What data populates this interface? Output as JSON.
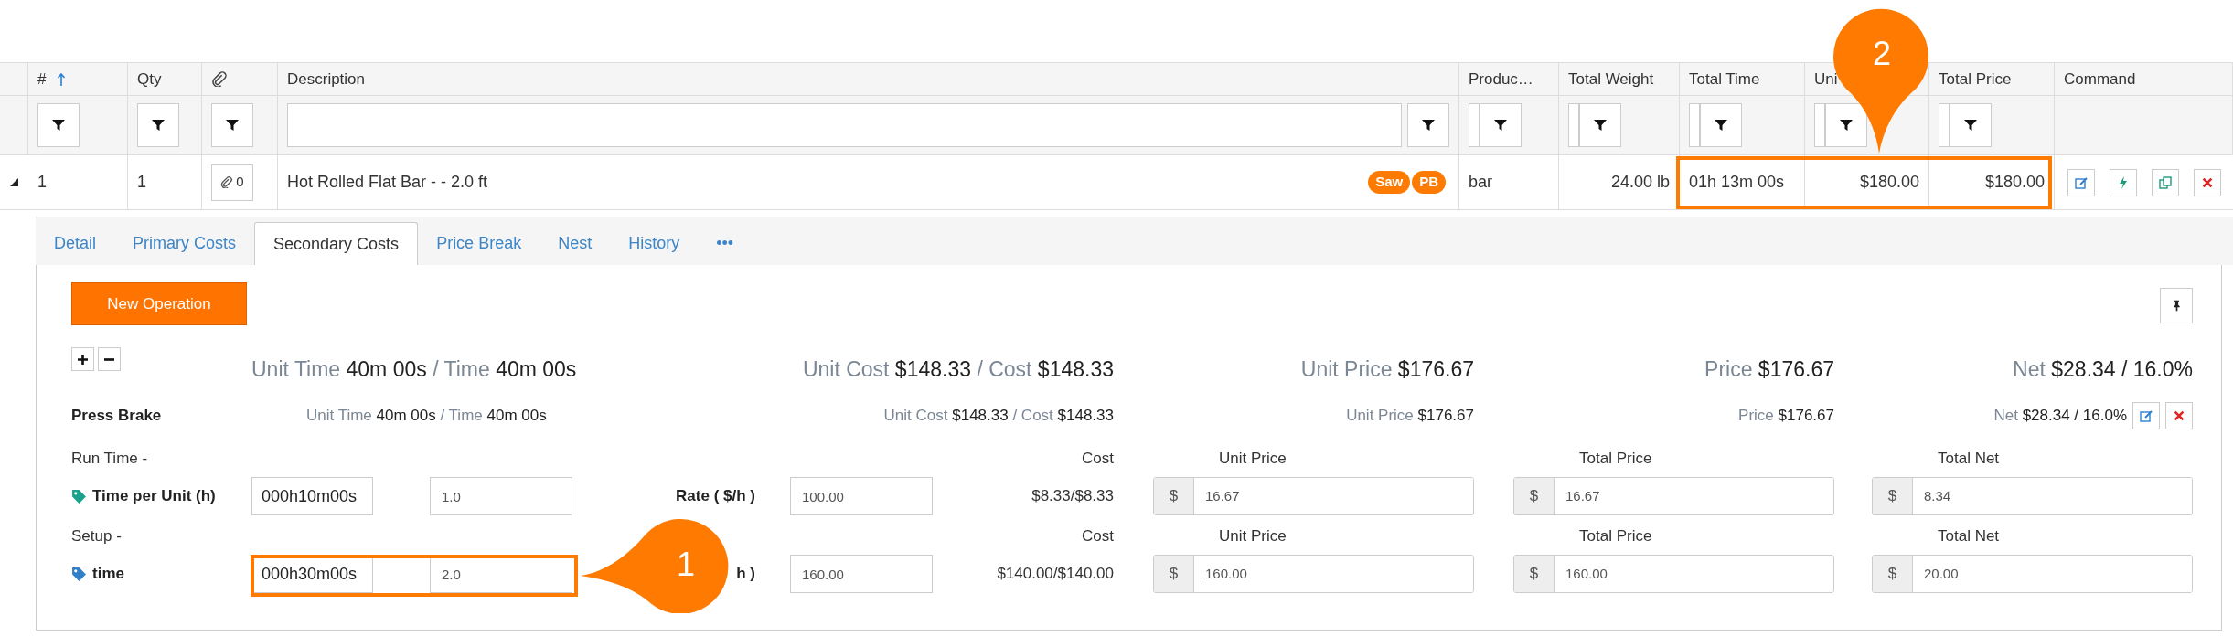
{
  "table": {
    "columns": [
      {
        "kind": "text",
        "label": "#",
        "sorted": true,
        "filter": {
          "kind": "button"
        }
      },
      {
        "kind": "text",
        "label": "Qty",
        "sorted": false,
        "filter": {
          "kind": "button"
        }
      },
      {
        "kind": "icon",
        "sorted": false,
        "filter": {
          "kind": "button"
        }
      },
      {
        "kind": "text",
        "label": "Description",
        "sorted": false,
        "filter": {
          "kind": "text"
        }
      },
      {
        "kind": "text",
        "label": "Produc…",
        "sorted": false,
        "filter": {
          "kind": "narrow"
        }
      },
      {
        "kind": "text",
        "label": "Total Weight",
        "sorted": false,
        "filter": {
          "kind": "narrow"
        }
      },
      {
        "kind": "text",
        "label": "Total Time",
        "sorted": false,
        "filter": {
          "kind": "narrow"
        }
      },
      {
        "kind": "text",
        "label": "Uni",
        "sorted": false,
        "filter": {
          "kind": "narrow"
        }
      },
      {
        "kind": "text",
        "label": "Total Price",
        "sorted": false,
        "filter": {
          "kind": "narrow"
        }
      },
      {
        "kind": "text",
        "label": "Command",
        "sorted": false
      }
    ],
    "rows": [
      {
        "expanded": true,
        "number": "1",
        "qty": "1",
        "attachments": "0",
        "description": "Hot Rolled Flat Bar - - 2.0 ft",
        "tags": [
          "Saw",
          "PB"
        ],
        "product": "bar",
        "total_weight": "24.00 lb",
        "total_time": "01h 13m 00s",
        "unit_price": "$180.00",
        "total_price": "$180.00"
      }
    ]
  },
  "detail_tabs": [
    {
      "label": "Detail",
      "selected": false
    },
    {
      "label": "Primary Costs",
      "selected": false
    },
    {
      "label": "Secondary Costs",
      "selected": true
    },
    {
      "label": "Price Break",
      "selected": false
    },
    {
      "label": "Nest",
      "selected": false
    },
    {
      "label": "History",
      "selected": false
    },
    {
      "label": "•••",
      "selected": false
    }
  ],
  "panel": {
    "new_operation_button": "New Operation",
    "totals": [
      [
        {
          "text": "Unit Time ",
          "kind": "label"
        },
        {
          "text": "40m 00s",
          "kind": "value"
        },
        {
          "text": " / Time ",
          "kind": "label"
        },
        {
          "text": "40m 00s",
          "kind": "value"
        }
      ],
      [
        {
          "text": "Unit Cost ",
          "kind": "label"
        },
        {
          "text": "$148.33",
          "kind": "value"
        },
        {
          "text": " / Cost ",
          "kind": "label"
        },
        {
          "text": "$148.33",
          "kind": "value"
        }
      ],
      [
        {
          "text": "Unit Price ",
          "kind": "label"
        },
        {
          "text": "$176.67",
          "kind": "value"
        }
      ],
      [
        {
          "text": "Price ",
          "kind": "label"
        },
        {
          "text": "$176.67",
          "kind": "value"
        }
      ],
      [
        {
          "text": "Net ",
          "kind": "label"
        },
        {
          "text": "$28.34 / 16.0%",
          "kind": "value"
        }
      ]
    ],
    "operations": [
      {
        "name": "Press Brake",
        "stats": [
          [
            {
              "text": "Unit Time ",
              "kind": "label"
            },
            {
              "text": "40m 00s",
              "kind": "value"
            },
            {
              "text": " / Time ",
              "kind": "label"
            },
            {
              "text": "40m 00s",
              "kind": "value"
            }
          ],
          [
            {
              "text": "Unit Cost ",
              "kind": "label"
            },
            {
              "text": "$148.33",
              "kind": "value"
            },
            {
              "text": " / Cost ",
              "kind": "label"
            },
            {
              "text": "$148.33",
              "kind": "value"
            }
          ],
          [
            {
              "text": "Unit Price ",
              "kind": "label"
            },
            {
              "text": "$176.67",
              "kind": "value"
            }
          ],
          [
            {
              "text": "Price ",
              "kind": "label"
            },
            {
              "text": "$176.67",
              "kind": "value"
            }
          ],
          [
            {
              "text": "Net ",
              "kind": "label"
            },
            {
              "text": "$28.34 / 16.0%",
              "kind": "value"
            }
          ]
        ]
      }
    ],
    "sections": [
      {
        "heading": "Run Time -",
        "color": "#1aa38c",
        "tag_label": "Time per Unit (h)",
        "time": "000h10m00s",
        "hours": "1.0",
        "rate_label": "Rate ( $/h )",
        "rate": "100.00",
        "cost_heading": "Cost",
        "cost": "$8.33/$8.33",
        "prices": [
          {
            "label": "Unit Price",
            "currency": "$",
            "value": "16.67"
          },
          {
            "label": "Total Price",
            "currency": "$",
            "value": "16.67"
          },
          {
            "label": "Total Net",
            "currency": "$",
            "value": "8.34"
          }
        ]
      },
      {
        "heading": "Setup -",
        "color": "#2f80c8",
        "tag_label": "time",
        "time": "000h30m00s",
        "hours": "2.0",
        "rate_label": "h )",
        "rate": "160.00",
        "cost_heading": "Cost",
        "cost": "$140.00/$140.00",
        "prices": [
          {
            "label": "Unit Price",
            "currency": "$",
            "value": "160.00"
          },
          {
            "label": "Total Price",
            "currency": "$",
            "value": "160.00"
          },
          {
            "label": "Total Net",
            "currency": "$",
            "value": "20.00"
          }
        ]
      }
    ]
  },
  "callouts": [
    {
      "number": "1"
    },
    {
      "number": "2"
    }
  ]
}
